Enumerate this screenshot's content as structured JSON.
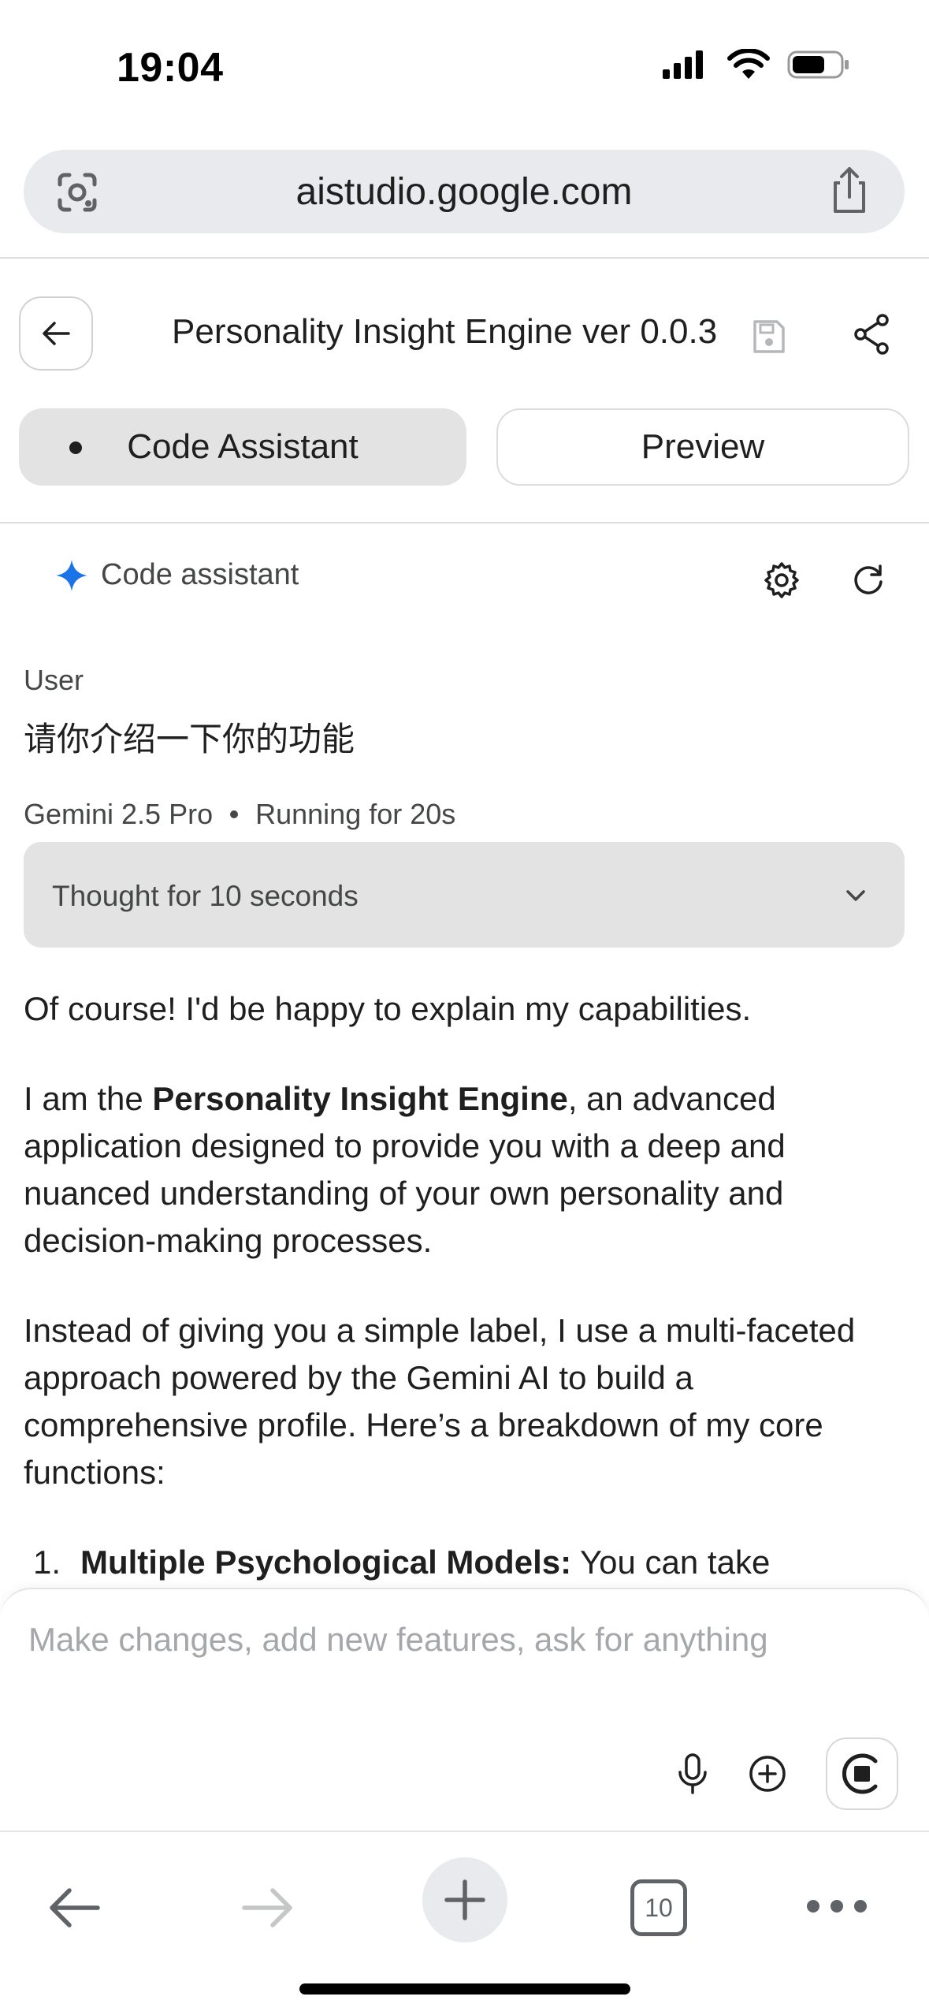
{
  "status_bar": {
    "time": "19:04"
  },
  "browser": {
    "url": "aistudio.google.com",
    "open_tabs": "10"
  },
  "app": {
    "title": "Personality Insight Engine ver 0.0.3",
    "tabs": [
      {
        "label": "Code Assistant",
        "active": true
      },
      {
        "label": "Preview",
        "active": false
      }
    ],
    "assistant_label": "Code assistant"
  },
  "conversation": {
    "user_role": "User",
    "user_message": "请你介绍一下你的功能",
    "model_name": "Gemini 2.5 Pro",
    "model_status": "Running for 20s",
    "thought_label": "Thought for 10 seconds",
    "response": {
      "p1": "Of course! I'd be happy to explain my capabilities.",
      "p2_pre": "I am the ",
      "p2_bold": "Personality Insight Engine",
      "p2_post": ", an advanced application designed to provide you with a deep and nuanced understanding of your own personality and decision-making processes.",
      "p3": "Instead of giving you a simple label, I use a multi-faceted approach powered by the Gemini AI to build a comprehensive profile. Here’s a breakdown of my core functions:",
      "list": [
        {
          "num": "1.",
          "bold": "Multiple Psychological Models:",
          "text": " You can take"
        }
      ]
    }
  },
  "composer": {
    "placeholder": "Make changes, add new features, ask for anything"
  },
  "colors": {
    "accent_blue": "#1a73e8",
    "tab_active_bg": "#e3e3e3",
    "url_bar_bg": "#e8eaed"
  },
  "icons": [
    "google-lens-icon",
    "share-icon",
    "back-arrow-icon",
    "save-icon",
    "share-nodes-icon",
    "sparkle-icon",
    "gear-icon",
    "refresh-icon",
    "chevron-down-icon",
    "mic-icon",
    "add-circle-icon",
    "stop-icon",
    "plus-icon",
    "more-icon"
  ]
}
